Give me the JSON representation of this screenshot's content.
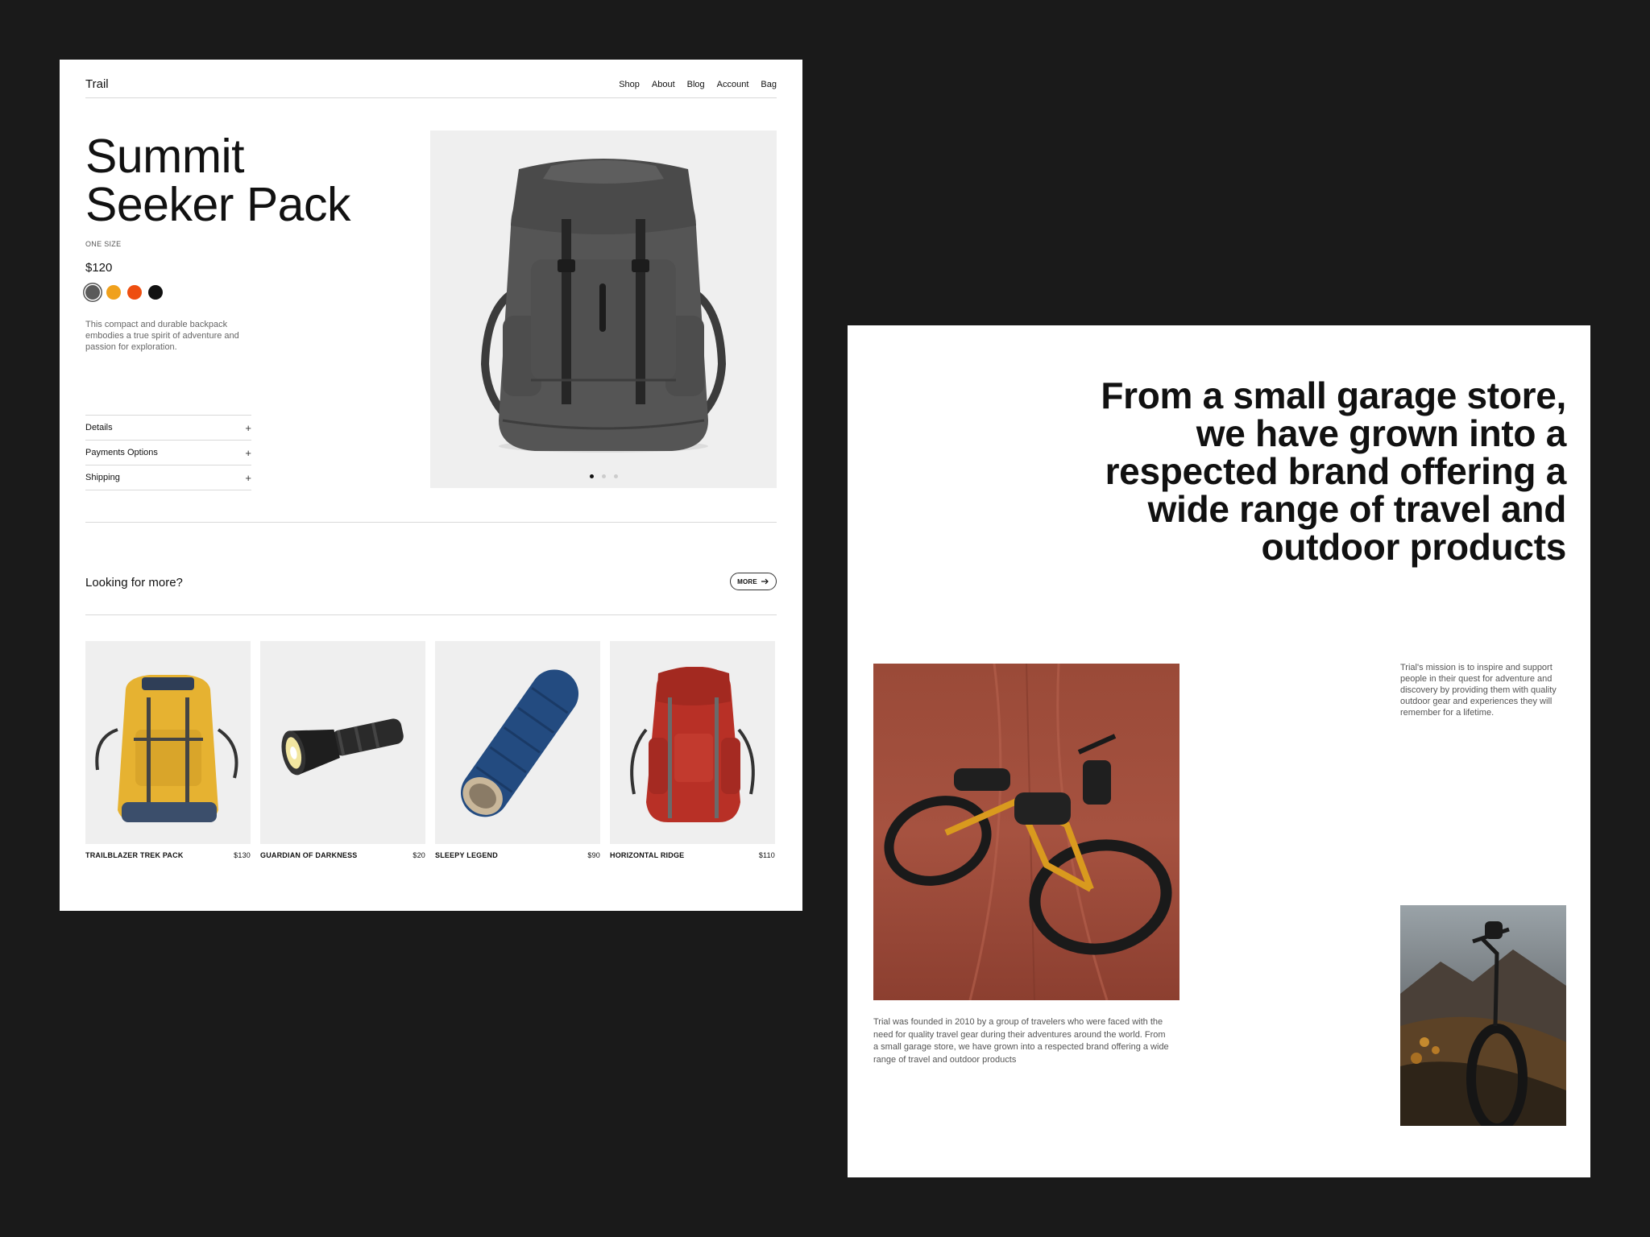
{
  "product_page": {
    "nav": {
      "logo": "Trail",
      "links": [
        "Shop",
        "About",
        "Blog",
        "Account",
        "Bag"
      ]
    },
    "product": {
      "title_line1": "Summit",
      "title_line2": "Seeker Pack",
      "size": "ONE SIZE",
      "price": "$120",
      "swatches": [
        "#5a5a5a",
        "#f0a11c",
        "#ee4e10",
        "#111111"
      ],
      "description": "This compact and durable backpack embodies a true spirit of adventure and passion for exploration.",
      "image_icon": "backpack-gray",
      "gallery_dots": 3,
      "gallery_active": 1
    },
    "accordion": [
      {
        "label": "Details",
        "icon": "+"
      },
      {
        "label": "Payments Options",
        "icon": "+"
      },
      {
        "label": "Shipping",
        "icon": "+"
      }
    ],
    "more": {
      "title": "Looking for more?",
      "button_label": "MORE",
      "button_icon": "arrow-right-icon"
    },
    "related": [
      {
        "name": "TRAILBLAZER TREK PACK",
        "price": "$130",
        "icon": "backpack-yellow"
      },
      {
        "name": "GUARDIAN OF DARKNESS",
        "price": "$20",
        "icon": "flashlight"
      },
      {
        "name": "SLEEPY LEGEND",
        "price": "$90",
        "icon": "sleeping-bag"
      },
      {
        "name": "HORIZONTAL RIDGE",
        "price": "$110",
        "icon": "backpack-red"
      }
    ]
  },
  "about_page": {
    "headline": "From a small garage store, we have grown into a respected brand offering a wide range of travel and outdoor products",
    "mission": "Trial's mission is to inspire and support people in their quest for adventure and discovery by providing them with quality outdoor gear and experiences they will remember for a lifetime.",
    "story": "Trial was founded in 2010 by a group of travelers who were faced with the need for quality travel gear during their adventures around the world. From a small garage store, we have grown into a respected brand offering a wide range of travel and outdoor products",
    "images": [
      "bike-on-dirt-road",
      "bike-on-mountain-trail"
    ]
  }
}
